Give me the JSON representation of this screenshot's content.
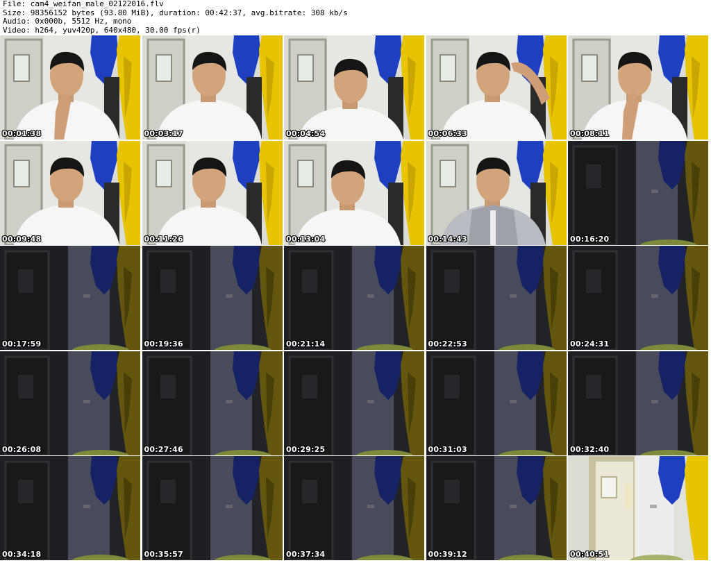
{
  "header": {
    "file_line": "File: cam4_weifan_male_02122016.flv",
    "size_line": "Size: 98356152 bytes (93.80 MiB), duration: 00:42:37, avg.bitrate: 308 kb/s",
    "audio_line": "Audio: 0x000b, 5512 Hz, mono",
    "video_line": "Video: h264, yuv420p, 640x480, 30.00 fps(r)"
  },
  "thumbnails": [
    {
      "time": "00:01:38",
      "scene": "person-hand-chin"
    },
    {
      "time": "00:03:17",
      "scene": "person-looking-up"
    },
    {
      "time": "00:04:54",
      "scene": "person-looking-down"
    },
    {
      "time": "00:06:33",
      "scene": "person-hand-head"
    },
    {
      "time": "00:08:11",
      "scene": "person-hand-chin"
    },
    {
      "time": "00:09:48",
      "scene": "person-talking"
    },
    {
      "time": "00:11:26",
      "scene": "person-neutral"
    },
    {
      "time": "00:13:04",
      "scene": "person-leaning"
    },
    {
      "time": "00:14:43",
      "scene": "person-hoodie"
    },
    {
      "time": "00:16:20",
      "scene": "dark-room"
    },
    {
      "time": "00:17:59",
      "scene": "dark-room"
    },
    {
      "time": "00:19:36",
      "scene": "dark-room"
    },
    {
      "time": "00:21:14",
      "scene": "dark-room"
    },
    {
      "time": "00:22:53",
      "scene": "dark-room"
    },
    {
      "time": "00:24:31",
      "scene": "dark-room"
    },
    {
      "time": "00:26:08",
      "scene": "dark-room"
    },
    {
      "time": "00:27:46",
      "scene": "dark-room"
    },
    {
      "time": "00:29:25",
      "scene": "dark-room"
    },
    {
      "time": "00:31:03",
      "scene": "dark-room"
    },
    {
      "time": "00:32:40",
      "scene": "dark-room"
    },
    {
      "time": "00:34:18",
      "scene": "dark-room"
    },
    {
      "time": "00:35:57",
      "scene": "dark-room"
    },
    {
      "time": "00:37:34",
      "scene": "dark-room"
    },
    {
      "time": "00:39:12",
      "scene": "dark-room"
    },
    {
      "time": "00:40:51",
      "scene": "lit-room-open-door"
    }
  ],
  "colors": {
    "background": "#ffffff",
    "text": "#000000",
    "timestamp": "#ffffff"
  }
}
